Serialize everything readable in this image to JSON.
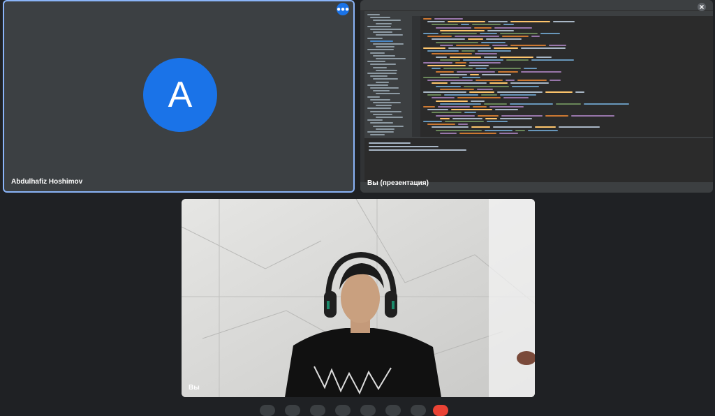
{
  "participants": {
    "remote": {
      "name": "Abdulhafiz Hoshimov",
      "avatar_letter": "A"
    },
    "presentation": {
      "name": "Вы (презентация)"
    },
    "self": {
      "name": "Вы"
    }
  },
  "icons": {
    "more": "more-options-icon",
    "close": "close-icon"
  },
  "colors": {
    "avatar": "#1a73e8",
    "active_border": "#8ab4f8",
    "background": "#1f2124",
    "end_call": "#ea4335"
  }
}
